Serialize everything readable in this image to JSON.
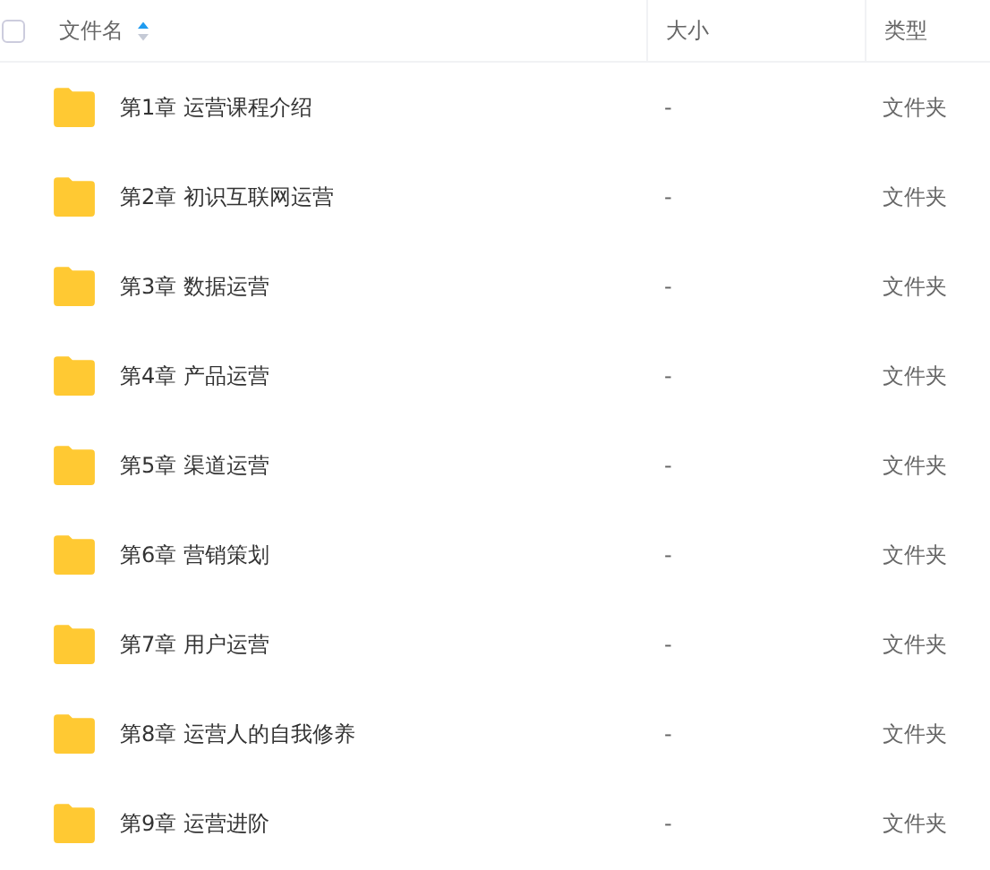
{
  "header": {
    "select_all": {
      "checked": false
    },
    "columns": [
      {
        "label": "文件名",
        "sorted": true,
        "ascending": true
      },
      {
        "label": "大小",
        "sorted": false
      },
      {
        "label": "类型",
        "sorted": false
      }
    ]
  },
  "rows": [
    {
      "name": "第1章 运营课程介绍",
      "size": "-",
      "type": "文件夹"
    },
    {
      "name": "第2章 初识互联网运营",
      "size": "-",
      "type": "文件夹"
    },
    {
      "name": "第3章 数据运营",
      "size": "-",
      "type": "文件夹"
    },
    {
      "name": "第4章 产品运营",
      "size": "-",
      "type": "文件夹"
    },
    {
      "name": "第5章 渠道运营",
      "size": "-",
      "type": "文件夹"
    },
    {
      "name": "第6章 营销策划",
      "size": "-",
      "type": "文件夹"
    },
    {
      "name": "第7章 用户运营",
      "size": "-",
      "type": "文件夹"
    },
    {
      "name": "第8章 运营人的自我修养",
      "size": "-",
      "type": "文件夹"
    },
    {
      "name": "第9章 运营进阶",
      "size": "-",
      "type": "文件夹"
    }
  ]
}
